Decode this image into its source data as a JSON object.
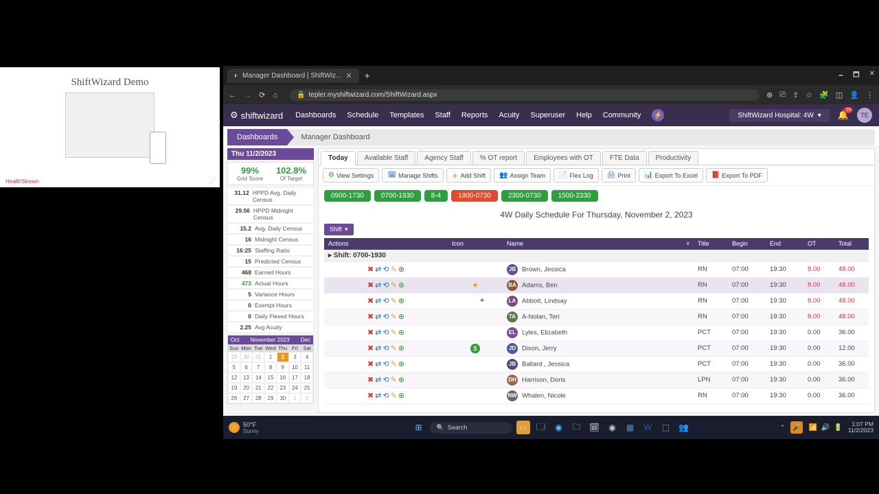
{
  "demo": {
    "title": "ShiftWizard Demo",
    "logo": "HealthStream"
  },
  "browser": {
    "tab_title": "Manager Dashboard | ShiftWiz...",
    "url": "tepler.myshiftwizard.com/ShiftWizard.aspx"
  },
  "nav": {
    "logo": "shiftwizard",
    "items": [
      "Dashboards",
      "Schedule",
      "Templates",
      "Staff",
      "Reports",
      "Acuity",
      "Superuser",
      "Help",
      "Community"
    ],
    "hospital": "ShiftWizard Hospital: 4W",
    "bell_count": "19",
    "avatar": "TE"
  },
  "breadcrumb": {
    "a": "Dashboards",
    "b": "Manager Dashboard"
  },
  "side": {
    "date": "Thu 11/2/2023",
    "grid_score": "99%",
    "grid_label": "Grid Score",
    "target": "102.8%",
    "target_label": "Of Target",
    "stats": [
      {
        "v": "31.12",
        "l": "HPPD Avg. Daily Census"
      },
      {
        "v": "29.56",
        "l": "HPPD Midnight Census"
      },
      {
        "v": "15.2",
        "l": "Avg. Daily Census"
      },
      {
        "v": "16",
        "l": "Midnight Census"
      },
      {
        "v": "16:25",
        "l": "Staffing Ratio"
      },
      {
        "v": "15",
        "l": "Predicted Census"
      },
      {
        "v": "468",
        "l": "Earned Hours"
      },
      {
        "v": "473",
        "l": "Actual Hours",
        "cls": "g"
      },
      {
        "v": "5",
        "l": "Variance Hours"
      },
      {
        "v": "0",
        "l": "Exempt Hours"
      },
      {
        "v": "0",
        "l": "Daily Flexed Hours"
      },
      {
        "v": "2.25",
        "l": "Avg Acuity"
      }
    ],
    "cal": {
      "prev": "Oct",
      "title": "November 2023",
      "next": "Dec",
      "dow": [
        "Sun",
        "Mon",
        "Tue",
        "Wed",
        "Thu",
        "Fri",
        "Sat"
      ],
      "days": [
        {
          "n": "29",
          "dim": 1
        },
        {
          "n": "30",
          "dim": 1
        },
        {
          "n": "31",
          "dim": 1
        },
        {
          "n": "1"
        },
        {
          "n": "2",
          "sel": 1
        },
        {
          "n": "3"
        },
        {
          "n": "4"
        },
        {
          "n": "5"
        },
        {
          "n": "6"
        },
        {
          "n": "7"
        },
        {
          "n": "8"
        },
        {
          "n": "9"
        },
        {
          "n": "10"
        },
        {
          "n": "11"
        },
        {
          "n": "12"
        },
        {
          "n": "13"
        },
        {
          "n": "14"
        },
        {
          "n": "15"
        },
        {
          "n": "16"
        },
        {
          "n": "17"
        },
        {
          "n": "18"
        },
        {
          "n": "19"
        },
        {
          "n": "20"
        },
        {
          "n": "21"
        },
        {
          "n": "22"
        },
        {
          "n": "23"
        },
        {
          "n": "24"
        },
        {
          "n": "25"
        },
        {
          "n": "26"
        },
        {
          "n": "27"
        },
        {
          "n": "28"
        },
        {
          "n": "29"
        },
        {
          "n": "30"
        },
        {
          "n": "1",
          "dim": 1
        },
        {
          "n": "2",
          "dim": 1
        }
      ]
    }
  },
  "tabs": [
    "Today",
    "Available Staff",
    "Agency Staff",
    "% OT report",
    "Employees with OT",
    "FTE Data",
    "Productivity"
  ],
  "active_tab": "Today",
  "toolbar": [
    {
      "ic": "⚙",
      "cls": "green",
      "l": "View Settings"
    },
    {
      "ic": "🗓",
      "cls": "blue",
      "l": "Manage Shifts"
    },
    {
      "ic": "＋",
      "cls": "green",
      "l": "Add Shift"
    },
    {
      "ic": "👥",
      "cls": "blue",
      "l": "Assign Team"
    },
    {
      "ic": "📄",
      "cls": "orange",
      "l": "Flex Log"
    },
    {
      "ic": "🖨",
      "cls": "blue",
      "l": "Print"
    },
    {
      "ic": "📊",
      "cls": "green",
      "l": "Export To Excel"
    },
    {
      "ic": "📕",
      "cls": "red",
      "l": "Export To PDF"
    }
  ],
  "chips": [
    {
      "l": "0900-1730"
    },
    {
      "l": "0700-1930"
    },
    {
      "l": "8-4"
    },
    {
      "l": "1900-0730",
      "red": 1
    },
    {
      "l": "2300-0730"
    },
    {
      "l": "1500-2330"
    }
  ],
  "schedule_title": "4W Daily Schedule For Thursday, November 2, 2023",
  "shift_label": "Shift",
  "columns": [
    "Actions",
    "Icon",
    "Name",
    "Title",
    "Begin",
    "End",
    "OT",
    "Total"
  ],
  "group_label": "Shift: 0700-1930",
  "rows": [
    {
      "init": "JB",
      "bg": "#6b4a9a",
      "name": "Brown, Jessica",
      "title": "RN",
      "begin": "07:00",
      "end": "19:30",
      "ot": "8.00",
      "total": "48.00",
      "otred": 1
    },
    {
      "init": "BA",
      "bg": "#8a5a3a",
      "name": "Adams, Ben",
      "title": "RN",
      "begin": "07:00",
      "end": "19:30",
      "ot": "8.00",
      "total": "48.00",
      "otred": 1,
      "icon": "star",
      "hl": 1
    },
    {
      "init": "LA",
      "bg": "#7a4a7a",
      "name": "Abbott, Lindsay",
      "title": "RN",
      "begin": "07:00",
      "end": "19:30",
      "ot": "8.00",
      "total": "48.00",
      "otred": 1
    },
    {
      "init": "TA",
      "bg": "#5a7a4a",
      "name": "A-Nolan, Teri",
      "title": "RN",
      "begin": "07:00",
      "end": "19:30",
      "ot": "8.00",
      "total": "48.00",
      "otred": 1
    },
    {
      "init": "EL",
      "bg": "#7a4a9a",
      "name": "Lyles, Elizabeth",
      "title": "PCT",
      "begin": "07:00",
      "end": "19:30",
      "ot": "0.00",
      "total": "36.00"
    },
    {
      "init": "JD",
      "bg": "#4a5a9a",
      "name": "Dixon, Jerry",
      "title": "PCT",
      "begin": "07:00",
      "end": "19:30",
      "ot": "0.00",
      "total": "12.00",
      "icon": "dollar"
    },
    {
      "init": "JB",
      "bg": "#5a4a7a",
      "name": "Ballard , Jessica",
      "title": "PCT",
      "begin": "07:00",
      "end": "19:30",
      "ot": "0.00",
      "total": "36.00"
    },
    {
      "init": "DH",
      "bg": "#9a6a4a",
      "name": "Harrison, Doris",
      "title": "LPN",
      "begin": "07:00",
      "end": "19:30",
      "ot": "0.00",
      "total": "36.00"
    },
    {
      "init": "NW",
      "bg": "#6a6a6a",
      "name": "Whalen, Nicole",
      "title": "RN",
      "begin": "07:00",
      "end": "19:30",
      "ot": "0.00",
      "total": "36.00"
    }
  ],
  "taskbar": {
    "temp": "50°F",
    "cond": "Sunny",
    "search": "Search",
    "time": "1:07 PM",
    "date": "11/2/2023"
  }
}
